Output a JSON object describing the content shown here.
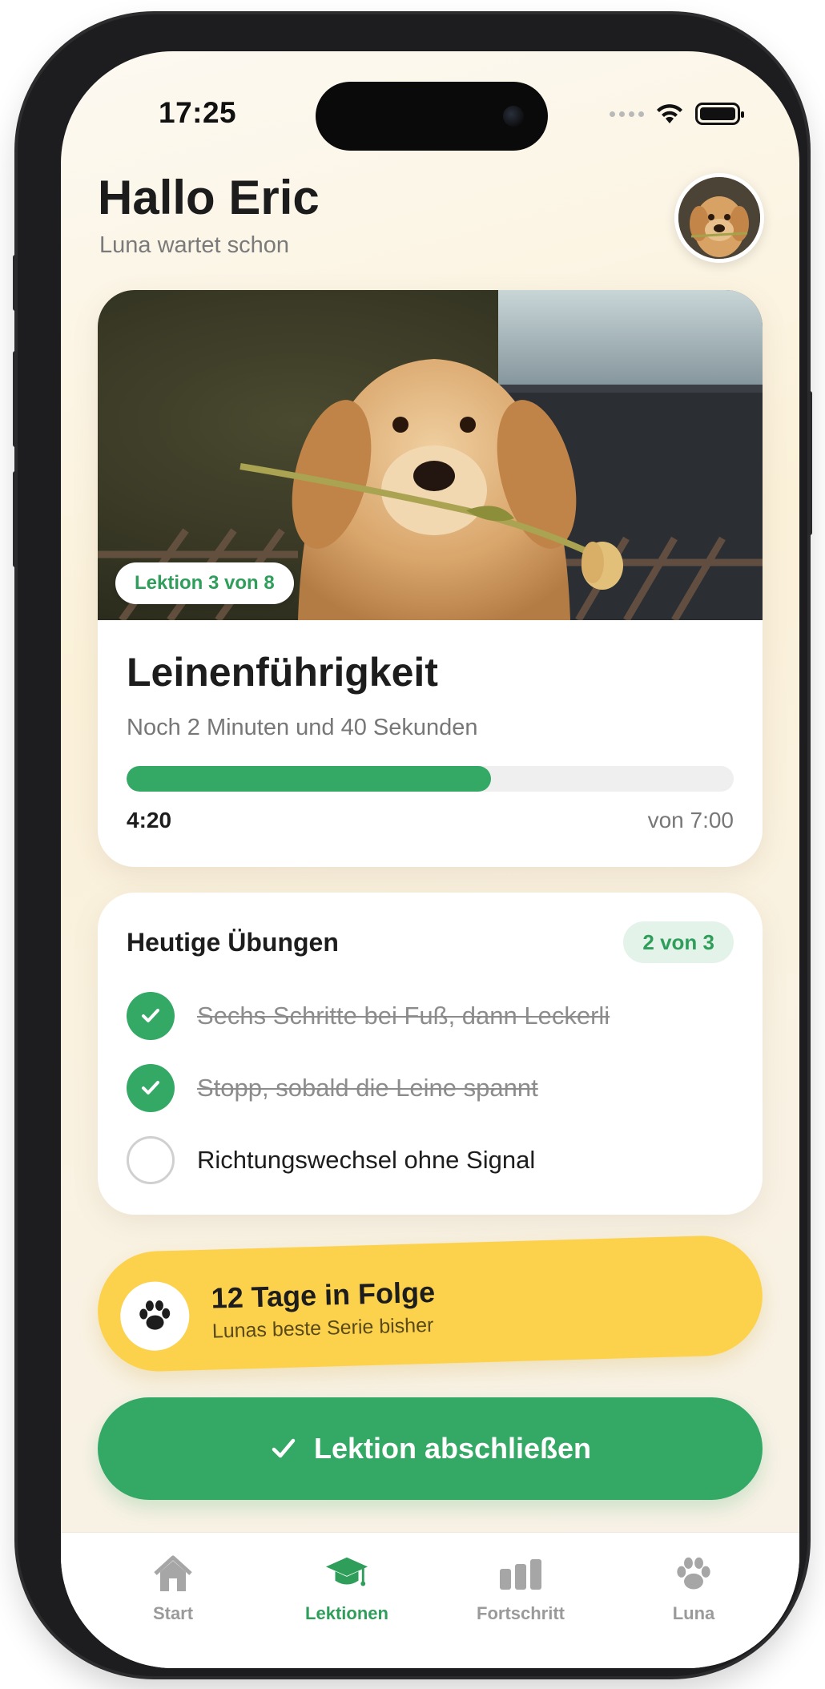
{
  "status_bar": {
    "time": "17:25"
  },
  "header": {
    "greeting": "Hallo Eric",
    "subtitle": "Luna wartet schon",
    "avatar_icon": "dog-avatar-photo"
  },
  "lesson": {
    "badge": "Lektion 3 von 8",
    "title": "Leinenführigkeit",
    "remaining": "Noch 2 Minuten und 40 Sekunden",
    "progress_fraction": 0.6,
    "time_current": "4:20",
    "time_total": "von 7:00",
    "progress_color": "#34a865",
    "hero_image": "golden-retriever-puppy-with-tulip"
  },
  "exercises": {
    "title": "Heutige Übungen",
    "count": "2 von 3",
    "items": [
      {
        "label": "Sechs Schritte bei Fuß, dann Leckerli",
        "done": true
      },
      {
        "label": "Stopp, sobald die Leine spannt",
        "done": true
      },
      {
        "label": "Richtungswechsel ohne Signal",
        "done": false
      }
    ]
  },
  "streak": {
    "title": "12 Tage in Folge",
    "subtitle": "Lunas beste Serie bisher",
    "icon": "paw-icon",
    "color": "#fcd24d"
  },
  "cta": {
    "label": "Lektion abschließen",
    "icon": "checkmark-icon"
  },
  "tabbar": {
    "tabs": [
      {
        "label": "Start",
        "icon": "home-icon",
        "active": false
      },
      {
        "label": "Lektionen",
        "icon": "graduation-cap-icon",
        "active": true
      },
      {
        "label": "Fortschritt",
        "icon": "bar-chart-icon",
        "active": false
      },
      {
        "label": "Luna",
        "icon": "paw-icon",
        "active": false
      }
    ]
  },
  "colors": {
    "accent": "#34a865",
    "streak": "#fcd24d",
    "background": "#fbf3e2"
  }
}
